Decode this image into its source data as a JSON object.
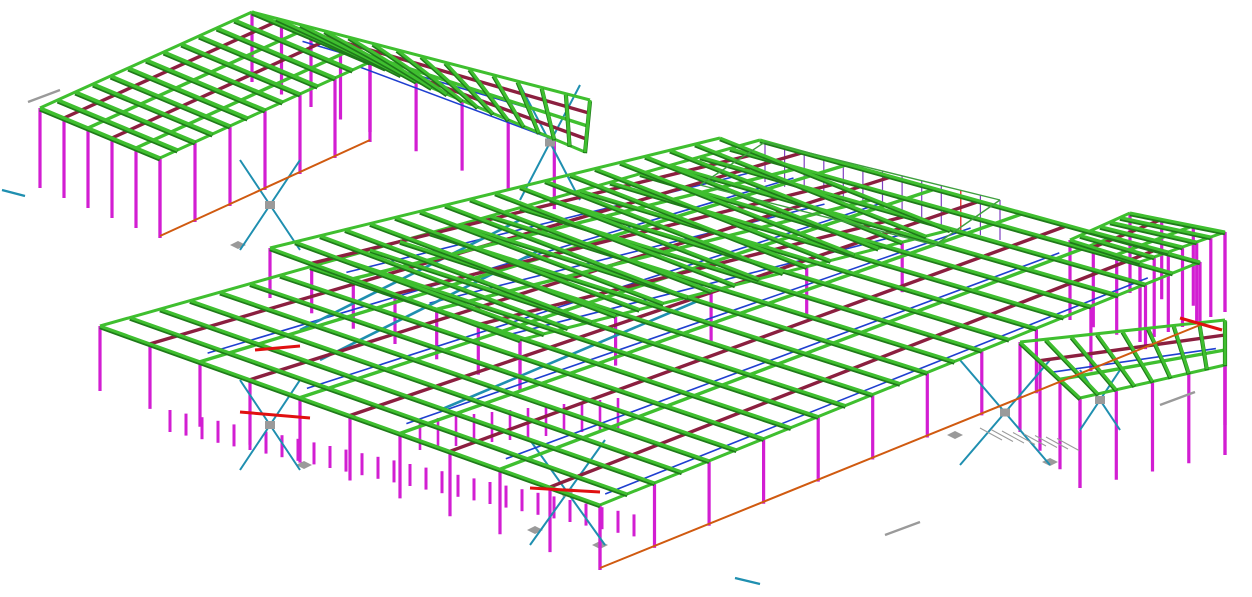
{
  "scene": {
    "description_text": "",
    "colors": {
      "background": "#ffffff",
      "beam": "#3fbf2f",
      "beam_edge": "#1f7a1a",
      "girder": "#8b1f3f",
      "column": "#d21ed2",
      "brace": "#1f8fb0",
      "secondary": "#1f3fd0",
      "edge_beam": "#d05a10",
      "highlight": "#e01010",
      "frame_line": "#3f9f3f",
      "grey": "#9a9a9a"
    }
  }
}
